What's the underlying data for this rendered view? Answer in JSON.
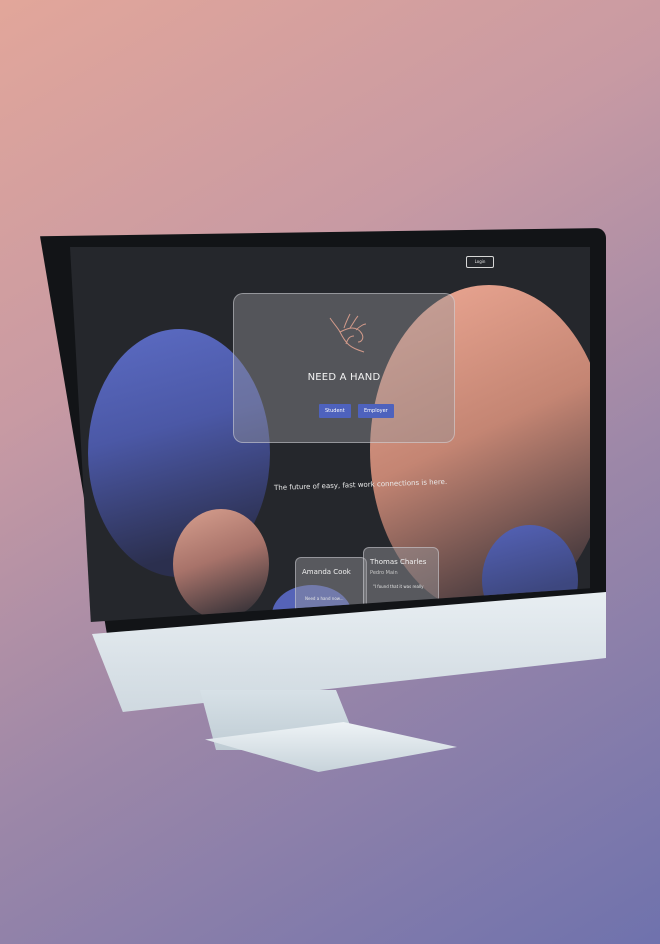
{
  "header": {
    "login_label": "Login"
  },
  "hero": {
    "title": "NEED A HAND",
    "student_label": "Student",
    "employer_label": "Employer"
  },
  "tagline": "The future of easy, fast work connections is here.",
  "testimonials": [
    {
      "name": "Amanda Cook",
      "quote": "Need a hand now..."
    },
    {
      "name": "Thomas Charles",
      "role": "Pedro Main",
      "quote": "\"I found that it was really"
    }
  ],
  "icons": {
    "hero_icon": "hand-icon"
  },
  "colors": {
    "background_top": "#e2a69a",
    "background_bottom": "#6f72ad",
    "screen_background": "#25272c",
    "accent_button": "#4e62bd",
    "blob_blue": "#5c6cc4",
    "blob_pink": "#eea995"
  }
}
